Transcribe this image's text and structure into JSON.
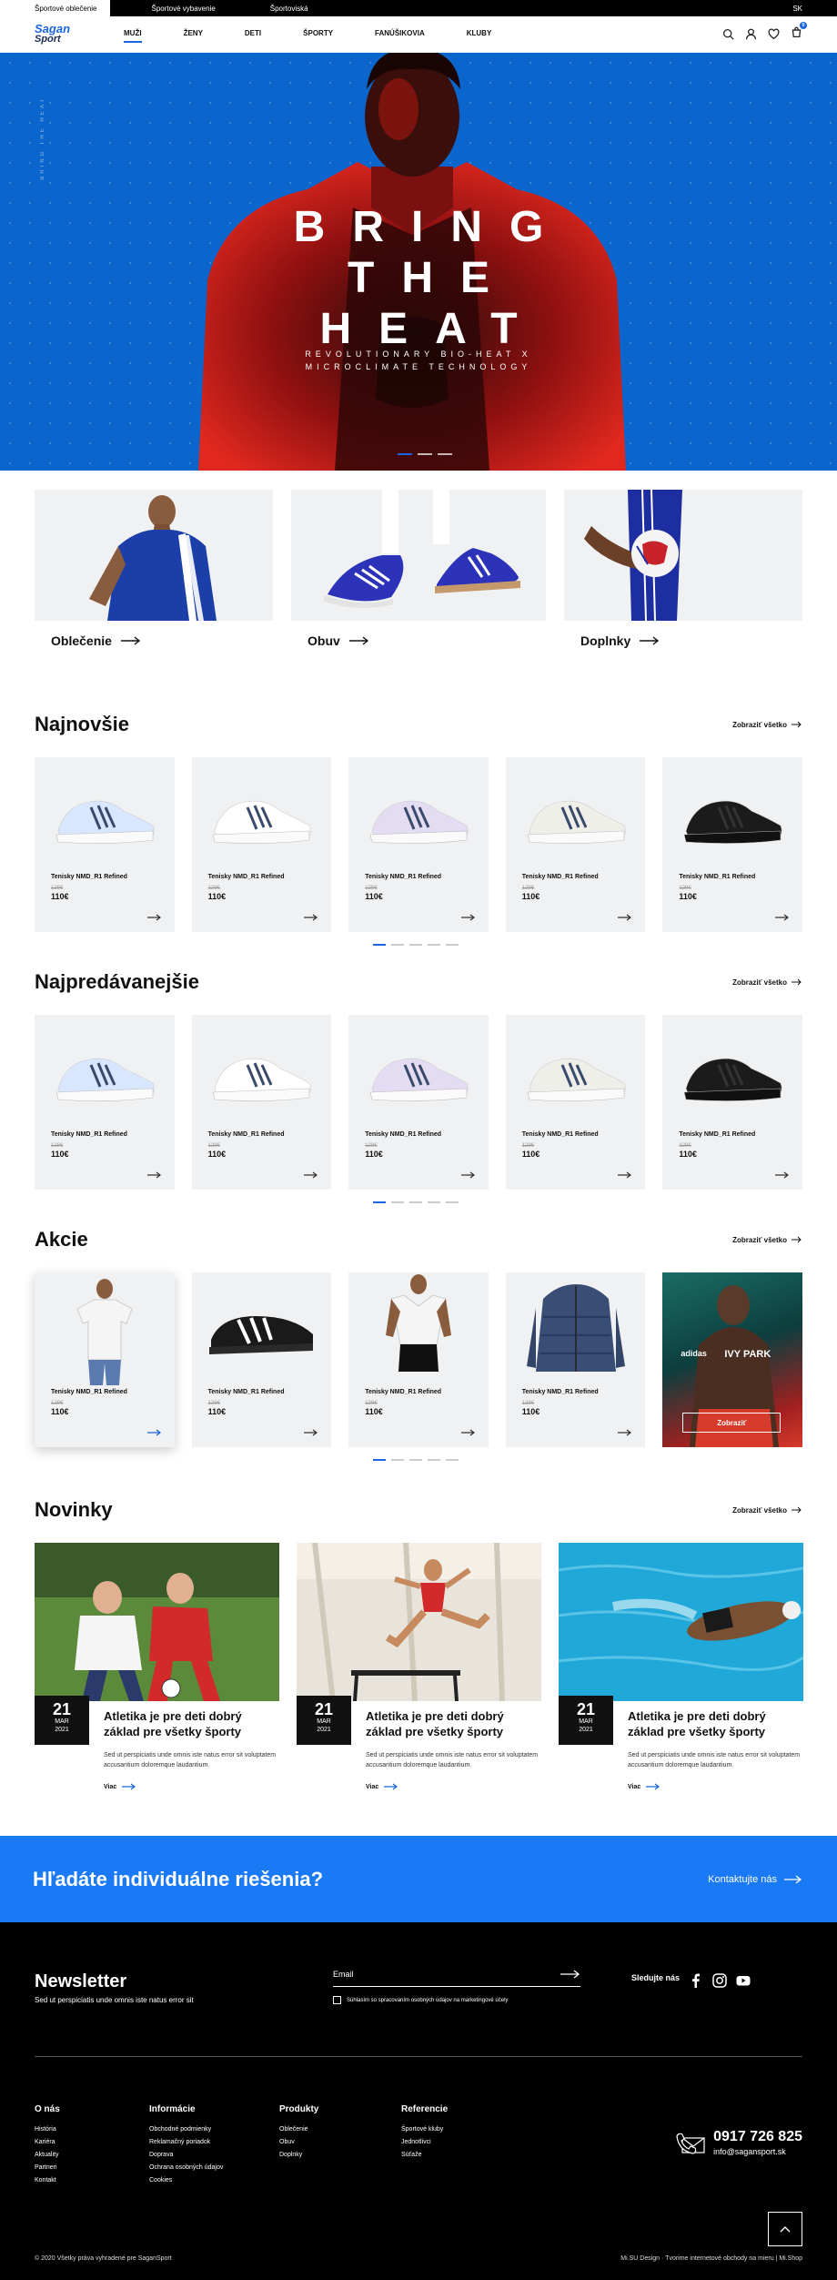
{
  "topbar": {
    "tabs": [
      "Športové oblečenie",
      "Športové vybavenie",
      "Športoviská"
    ],
    "language": "SK"
  },
  "header": {
    "logo_top": "Sagan",
    "logo_bottom": "Sport",
    "nav": [
      "MUŽI",
      "ŽENY",
      "DETI",
      "ŠPORTY",
      "FANÚŠIKOVIA",
      "KLUBY"
    ],
    "cart_count": "0"
  },
  "hero": {
    "side_text": "BRING THE HEAT",
    "line1": "BRING",
    "line2": "THE",
    "line3": "HEAT",
    "sub1": "REVOLUTIONARY BIO-HEAT X",
    "sub2": "MICROCLIMATE TECHNOLOGY",
    "slides": 3,
    "active_slide": 1
  },
  "categories": [
    {
      "label": "Oblečenie",
      "icon": "tshirt"
    },
    {
      "label": "Obuv",
      "icon": "shoe"
    },
    {
      "label": "Doplnky",
      "icon": "ball"
    }
  ],
  "sections": {
    "newest": {
      "title": "Najnovšie",
      "view_all": "Zobraziť všetko",
      "products": [
        {
          "name": "Tenisky NMD_R1 Refined",
          "old_price": "129€",
          "price": "110€",
          "color": "#d8e6ff"
        },
        {
          "name": "Tenisky NMD_R1 Refined",
          "old_price": "129€",
          "price": "110€",
          "color": "#ffffff"
        },
        {
          "name": "Tenisky NMD_R1 Refined",
          "old_price": "129€",
          "price": "110€",
          "color": "#e4dcf2"
        },
        {
          "name": "Tenisky NMD_R1 Refined",
          "old_price": "129€",
          "price": "110€",
          "color": "#efefea"
        },
        {
          "name": "Tenisky NMD_R1 Refined",
          "old_price": "129€",
          "price": "110€",
          "color": "#1b1b1b"
        }
      ]
    },
    "bestsellers": {
      "title": "Najpredávanejšie",
      "view_all": "Zobraziť všetko",
      "products": [
        {
          "name": "Tenisky NMD_R1 Refined",
          "old_price": "129€",
          "price": "110€",
          "color": "#d8e6ff"
        },
        {
          "name": "Tenisky NMD_R1 Refined",
          "old_price": "129€",
          "price": "110€",
          "color": "#ffffff"
        },
        {
          "name": "Tenisky NMD_R1 Refined",
          "old_price": "129€",
          "price": "110€",
          "color": "#e4dcf2"
        },
        {
          "name": "Tenisky NMD_R1 Refined",
          "old_price": "129€",
          "price": "110€",
          "color": "#efefea"
        },
        {
          "name": "Tenisky NMD_R1 Refined",
          "old_price": "129€",
          "price": "110€",
          "color": "#1b1b1b"
        }
      ]
    },
    "sales": {
      "title": "Akcie",
      "view_all": "Zobraziť všetko",
      "products": [
        {
          "name": "Tenisky NMD_R1 Refined",
          "old_price": "129€",
          "price": "110€",
          "kind": "tshirt"
        },
        {
          "name": "Tenisky NMD_R1 Refined",
          "old_price": "129€",
          "price": "110€",
          "kind": "slide"
        },
        {
          "name": "Tenisky NMD_R1 Refined",
          "old_price": "129€",
          "price": "110€",
          "kind": "tank"
        },
        {
          "name": "Tenisky NMD_R1 Refined",
          "old_price": "129€",
          "price": "110€",
          "kind": "jacket"
        }
      ],
      "promo": {
        "brand1": "adidas",
        "brand2": "IVY PARK",
        "button": "Zobraziť"
      }
    }
  },
  "news": {
    "title": "Novinky",
    "view_all": "Zobraziť všetko",
    "items": [
      {
        "day": "21",
        "month": "MAR",
        "year": "2021",
        "title": "Atletika je pre deti dobrý základ pre všetky športy",
        "text": "Sed ut perspiciatis unde omnis iste natus error sit voluptatem accusantium doloremque laudantium.",
        "more": "Viac",
        "scene": "football"
      },
      {
        "day": "21",
        "month": "MAR",
        "year": "2021",
        "title": "Atletika je pre deti dobrý základ pre všetky športy",
        "text": "Sed ut perspiciatis unde omnis iste natus error sit voluptatem accusantium doloremque laudantium.",
        "more": "Viac",
        "scene": "hurdles"
      },
      {
        "day": "21",
        "month": "MAR",
        "year": "2021",
        "title": "Atletika je pre deti dobrý základ pre všetky športy",
        "text": "Sed ut perspiciatis unde omnis iste natus error sit voluptatem accusantium doloremque laudantium.",
        "more": "Viac",
        "scene": "swim"
      }
    ]
  },
  "cta": {
    "title": "Hľadáte individuálne riešenia?",
    "link": "Kontaktujte nás"
  },
  "footer": {
    "newsletter_title": "Newsletter",
    "newsletter_text": "Sed ut perspiciatis unde omnis iste natus error sit",
    "email_placeholder": "Email",
    "consent": "Súhlasím so spracovaním osobných údajov na marketingové účely",
    "follow": "Sledujte nás",
    "columns": [
      {
        "title": "O nás",
        "links": [
          "História",
          "Kariéra",
          "Aktuality",
          "Partneri",
          "Kontakt"
        ]
      },
      {
        "title": "Informácie",
        "links": [
          "Obchodné podmienky",
          "Reklamačný poriadok",
          "Doprava",
          "Ochrana osobných údajov",
          "Cookies"
        ]
      },
      {
        "title": "Produkty",
        "links": [
          "Oblečenie",
          "Obuv",
          "Doplnky"
        ]
      },
      {
        "title": "Referencie",
        "links": [
          "Športové kluby",
          "Jednotlivci",
          "Súťaže"
        ]
      }
    ],
    "phone": "0917 726 825",
    "email": "info@sagansport.sk",
    "copyright": "© 2020 Všetky práva vyhradené pre SaganSport",
    "credit": "Mi.SU Design · Tvorime internetové obchody na mieru | Mi.Shop"
  },
  "colors": {
    "accent": "#1a66e0",
    "cta": "#1a7af5",
    "hero": "#0a66cc"
  }
}
